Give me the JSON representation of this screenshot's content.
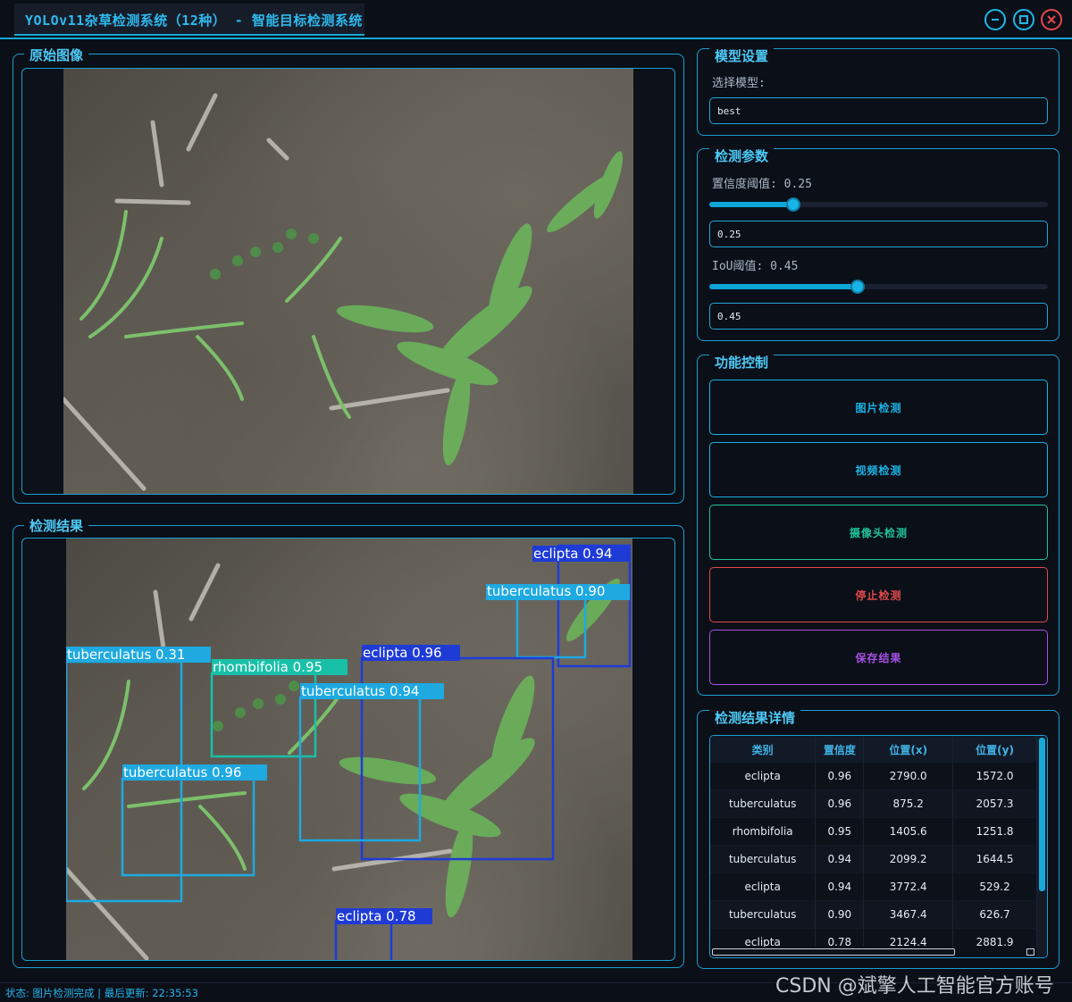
{
  "window": {
    "title": "YOLOv11杂草检测系统（12种） - 智能目标检测系统",
    "minimize_icon": "minimize-icon",
    "maximize_icon": "maximize-icon",
    "close_icon": "close-icon"
  },
  "original_panel": {
    "title": "原始图像"
  },
  "result_panel": {
    "title": "检测结果",
    "detections": [
      {
        "label": "eclipta 0.94",
        "color": "#1f3bd6"
      },
      {
        "label": "tuberculatus 0.90",
        "color": "#1ea9e1"
      },
      {
        "label": "tuberculatus 0.31",
        "color": "#1ea9e1"
      },
      {
        "label": "rhombifolia 0.95",
        "color": "#19c0a8"
      },
      {
        "label": "eclipta 0.96",
        "color": "#1f3bd6"
      },
      {
        "label": "tuberculatus 0.94",
        "color": "#1ea9e1"
      },
      {
        "label": "tuberculatus 0.96",
        "color": "#1ea9e1"
      },
      {
        "label": "eclipta 0.78",
        "color": "#1f3bd6"
      }
    ]
  },
  "model_settings": {
    "title": "模型设置",
    "select_label": "选择模型:",
    "selected_model": "best"
  },
  "detection_params": {
    "title": "检测参数",
    "confidence_label": "置信度阈值: 0.25",
    "confidence_value": "0.25",
    "confidence_level": 0.25,
    "iou_label": "IoU阈值: 0.45",
    "iou_value": "0.45",
    "iou_level": 0.45
  },
  "controls": {
    "title": "功能控制",
    "image_detect": "图片检测",
    "video_detect": "视频检测",
    "camera_detect": "摄像头检测",
    "stop_detect": "停止检测",
    "save_results": "保存结果",
    "colors": {
      "image_detect": "#1ab4e6",
      "video_detect": "#1ab4e6",
      "camera_detect": "#1fc29a",
      "stop_detect": "#e04a4d",
      "save_results": "#a450e3"
    }
  },
  "details": {
    "title": "检测结果详情",
    "columns": [
      "类别",
      "置信度",
      "位置(x)",
      "位置(y)"
    ],
    "rows": [
      [
        "eclipta",
        "0.96",
        "2790.0",
        "1572.0"
      ],
      [
        "tuberculatus",
        "0.96",
        "875.2",
        "2057.3"
      ],
      [
        "rhombifolia",
        "0.95",
        "1405.6",
        "1251.8"
      ],
      [
        "tuberculatus",
        "0.94",
        "2099.2",
        "1644.5"
      ],
      [
        "eclipta",
        "0.94",
        "3772.4",
        "529.2"
      ],
      [
        "tuberculatus",
        "0.90",
        "3467.4",
        "626.7"
      ],
      [
        "eclipta",
        "0.78",
        "2124.4",
        "2881.9"
      ]
    ]
  },
  "status_bar": {
    "text": "状态: 图片检测完成 | 最后更新: 22:35:53"
  },
  "watermark": {
    "text": "CSDN @斌擎人工智能官方账号"
  }
}
